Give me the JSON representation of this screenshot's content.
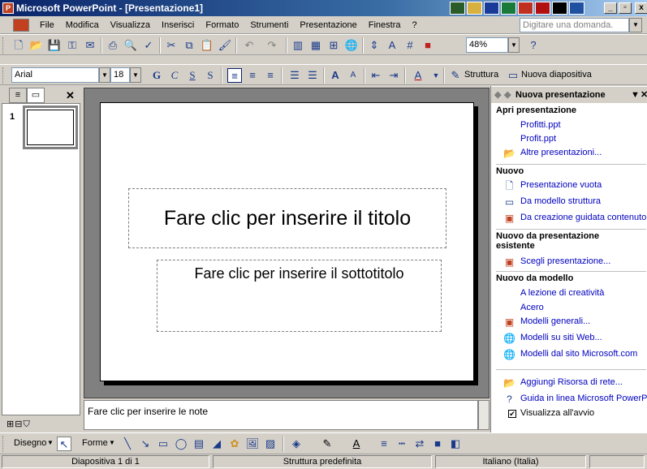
{
  "window": {
    "title": "Microsoft PowerPoint - [Presentazione1]",
    "app_icon": "powerpoint-icon",
    "min": "_",
    "restore": "▫",
    "close": "x"
  },
  "menu": {
    "items": [
      "File",
      "Modifica",
      "Visualizza",
      "Inserisci",
      "Formato",
      "Strumenti",
      "Presentazione",
      "Finestra",
      "?"
    ],
    "ask_placeholder": "Digitare una domanda."
  },
  "formatting": {
    "font": "Arial",
    "size": "18",
    "zoom": "48%",
    "design_label": "Struttura",
    "new_slide_label": "Nuova diapositiva"
  },
  "slide": {
    "title_placeholder": "Fare clic per inserire il titolo",
    "subtitle_placeholder": "Fare clic per inserire il sottotitolo",
    "number": "1"
  },
  "notes": {
    "placeholder": "Fare clic per inserire le note"
  },
  "taskpane": {
    "title": "Nuova presentazione",
    "open_header": "Apri presentazione",
    "recent": [
      "Profitti.ppt",
      "Profit.ppt"
    ],
    "more_presentations": "Altre presentazioni...",
    "new_header": "Nuovo",
    "new_items": [
      "Presentazione vuota",
      "Da modello struttura",
      "Da creazione guidata contenuto"
    ],
    "existing_header": "Nuovo da presentazione esistente",
    "existing_item": "Scegli presentazione...",
    "template_header": "Nuovo da modello",
    "template_items": [
      "A lezione di creatività",
      "Acero",
      "Modelli generali...",
      "Modelli su siti Web...",
      "Modelli dal sito Microsoft.com"
    ],
    "network": "Aggiungi Risorsa di rete...",
    "help": "Guida in linea Microsoft PowerPoint",
    "show_at_startup": "Visualizza all'avvio"
  },
  "drawing": {
    "draw_label": "Disegno",
    "shapes_label": "Forme"
  },
  "status": {
    "slide": "Diapositiva 1 di 1",
    "design": "Struttura predefinita",
    "language": "Italiano (Italia)"
  }
}
